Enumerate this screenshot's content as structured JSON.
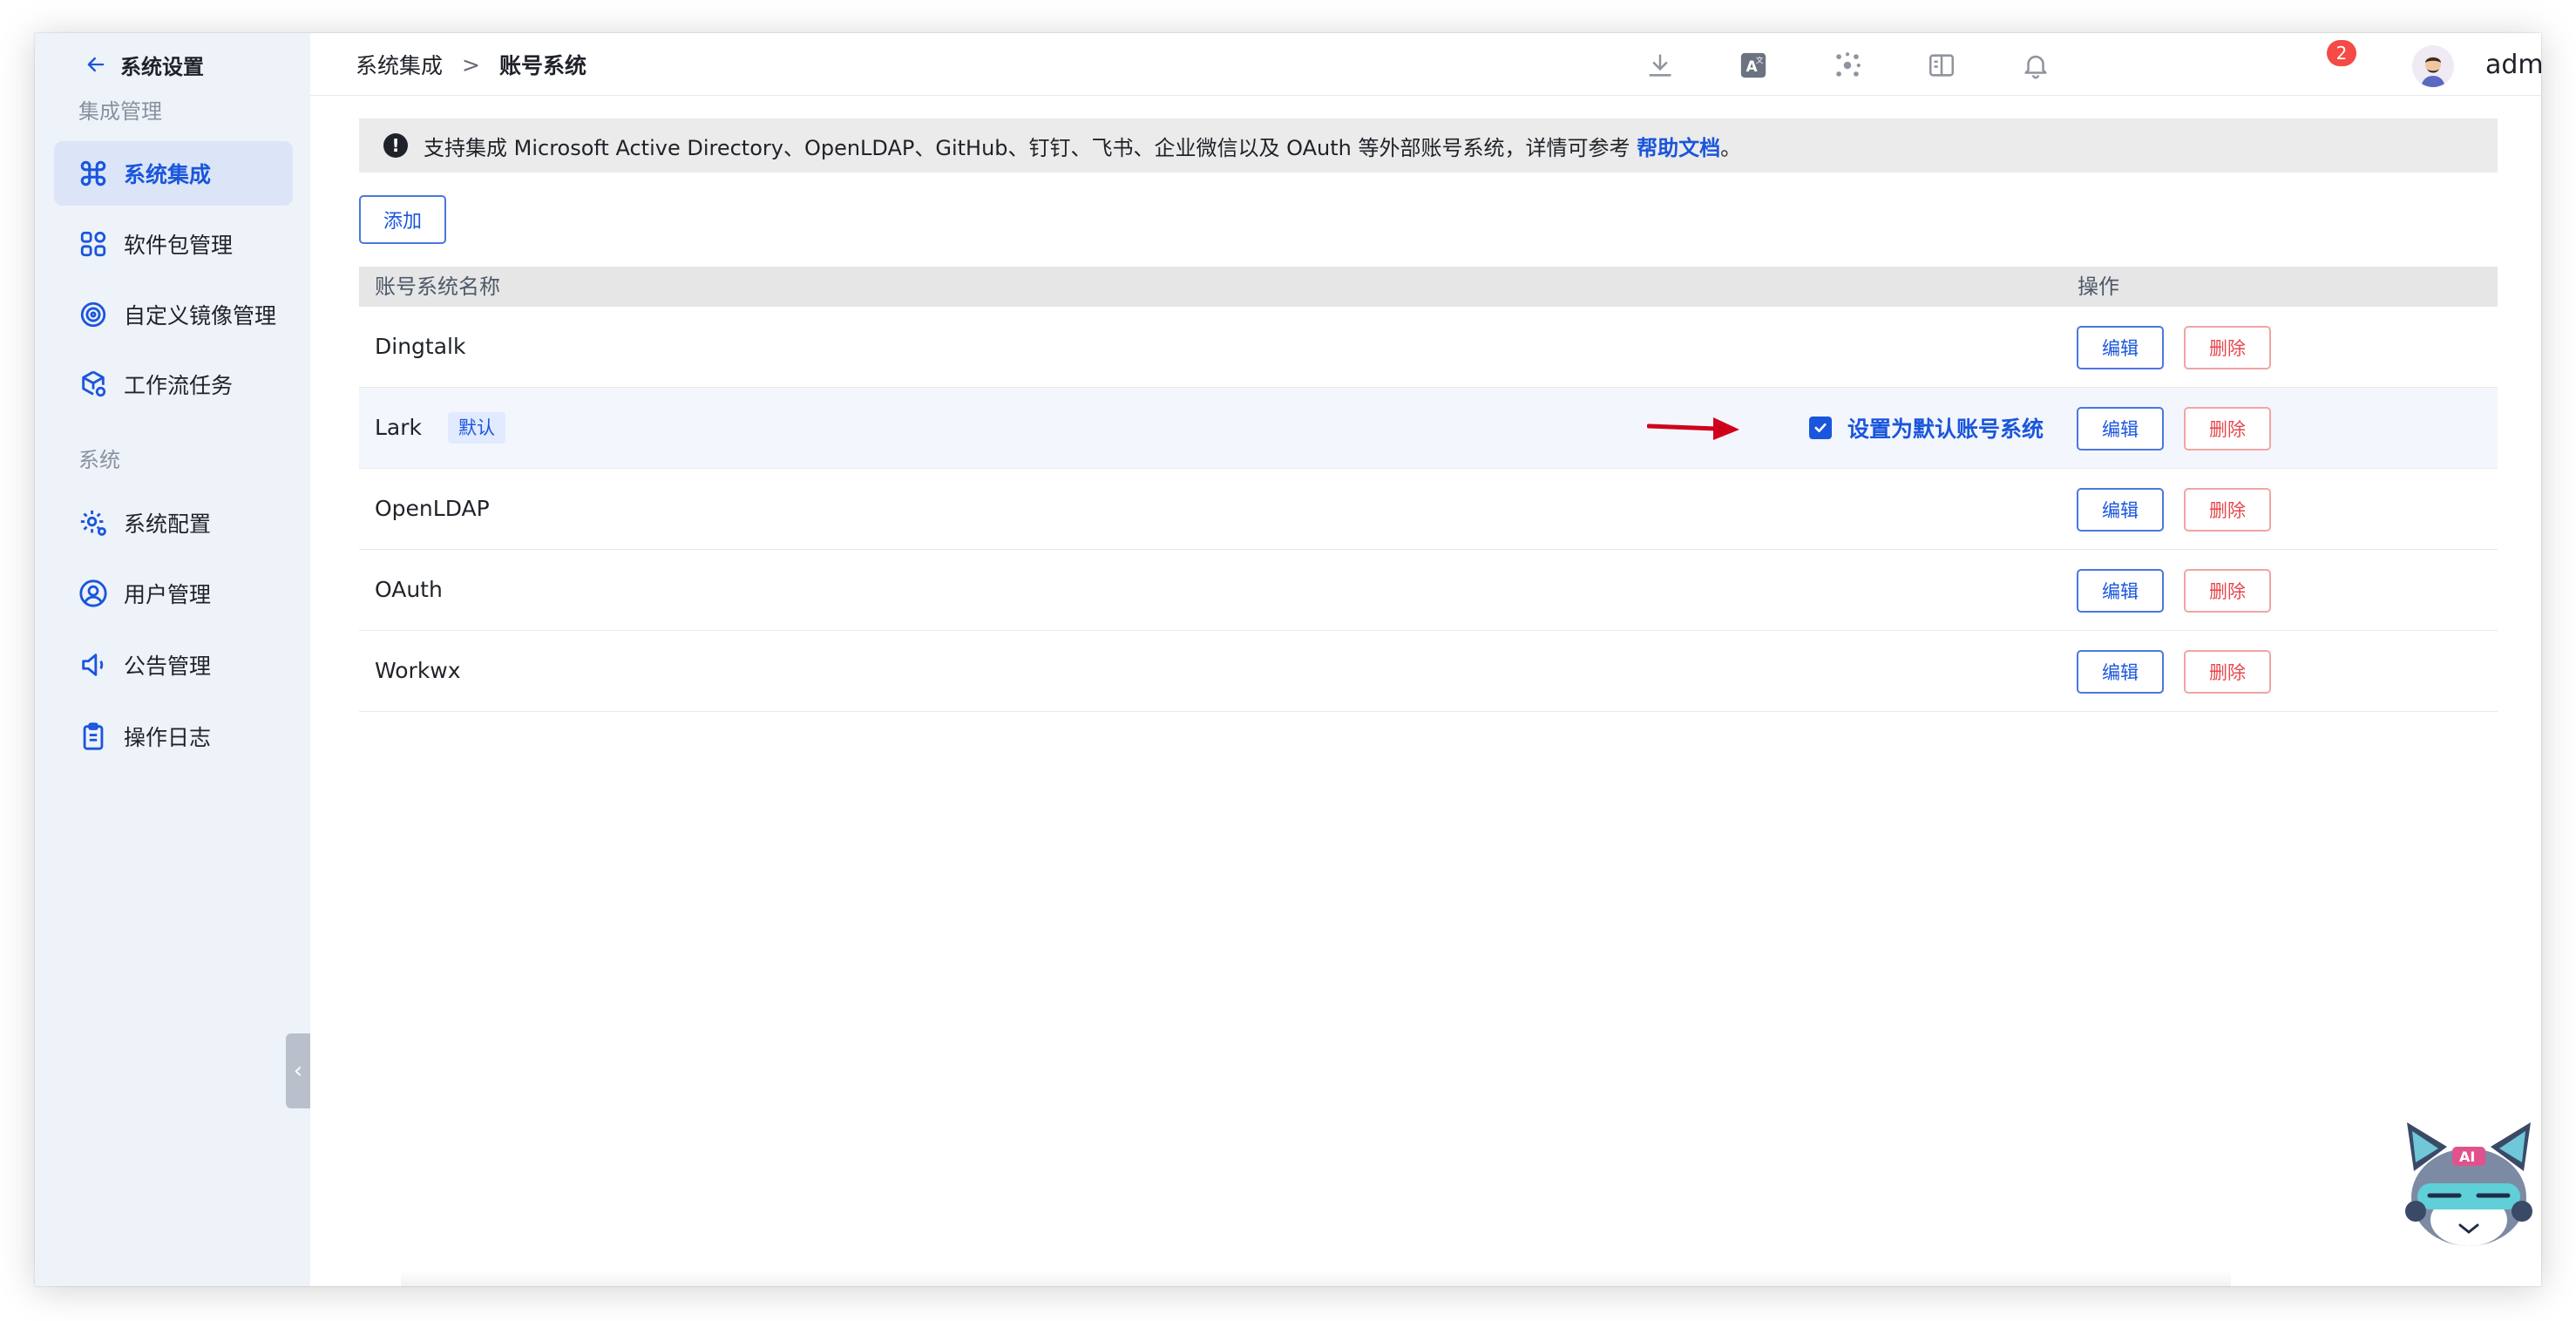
{
  "sidebar": {
    "back_label": "系统设置",
    "group_integration": "集成管理",
    "group_system": "系统",
    "items": [
      {
        "label": "系统集成",
        "icon": "command-icon",
        "active": true
      },
      {
        "label": "软件包管理",
        "icon": "grid-icon"
      },
      {
        "label": "自定义镜像管理",
        "icon": "disc-icon"
      },
      {
        "label": "工作流任务",
        "icon": "cube-gear-icon"
      },
      {
        "label": "系统配置",
        "icon": "settings-gear-icon"
      },
      {
        "label": "用户管理",
        "icon": "user-circle-icon"
      },
      {
        "label": "公告管理",
        "icon": "speaker-icon"
      },
      {
        "label": "操作日志",
        "icon": "clipboard-icon"
      }
    ]
  },
  "header": {
    "breadcrumb_parent": "系统集成",
    "breadcrumb_sep": ">",
    "breadcrumb_current": "账号系统",
    "notification_count": "2",
    "username": "admin(admin)"
  },
  "notice": {
    "text": "支持集成 Microsoft Active Directory、OpenLDAP、GitHub、钉钉、飞书、企业微信以及 OAuth 等外部账号系统，详情可参考",
    "link": "帮助文档",
    "suffix": "。"
  },
  "add_button": "添加",
  "table": {
    "col_name": "账号系统名称",
    "col_actions": "操作",
    "edit_label": "编辑",
    "delete_label": "删除",
    "default_tag": "默认",
    "set_default_label": "设置为默认账号系统",
    "rows": [
      {
        "name": "Dingtalk"
      },
      {
        "name": "Lark"
      },
      {
        "name": "OpenLDAP"
      },
      {
        "name": "OAuth"
      },
      {
        "name": "Workwx"
      }
    ]
  },
  "mascot": {
    "badge": "AI"
  },
  "colors": {
    "accent": "#1a56db",
    "danger": "#e5484d",
    "sidebar_bg": "#eef2f9",
    "arrow": "#d0021b"
  }
}
